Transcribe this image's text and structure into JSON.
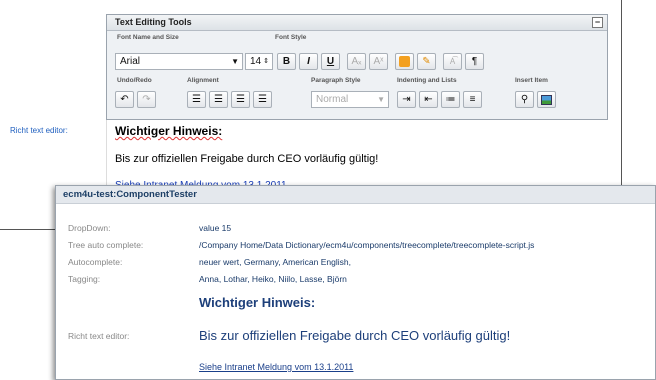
{
  "back_panel": {
    "rte_label": "Richt text editor:",
    "tools_title": "Text Editing Tools",
    "collapse_symbol": "−",
    "groups": {
      "font_name_size": "Font Name and Size",
      "font_style": "Font Style",
      "undo_redo": "Undo/Redo",
      "alignment": "Alignment",
      "paragraph_style": "Paragraph Style",
      "indenting_lists": "Indenting and Lists",
      "insert_item": "Insert Item"
    },
    "font_name": "Arial",
    "font_size": "14",
    "paragraph_style_value": "Normal",
    "buttons": {
      "bold": "B",
      "italic": "I",
      "underline": "U",
      "subscript": "Aₓ",
      "superscript": "Aˣ",
      "pilcrow": "¶"
    },
    "editor": {
      "heading": "Wichtiger Hinweis:",
      "body": "Bis zur offiziellen Freigabe durch CEO vorläufig gültig!",
      "link": "Siehe Intranet Meldung vom 13.1.2011"
    }
  },
  "front_panel": {
    "title": "ecm4u-test:ComponentTester",
    "rows": [
      {
        "label": "DropDown:",
        "value": "value 15"
      },
      {
        "label": "Tree auto complete:",
        "value": "/Company Home/Data Dictionary/ecm4u/components/treecomplete/treecomplete-script.js"
      },
      {
        "label": "Autocomplete:",
        "value": "neuer wert, Germany, American English,"
      },
      {
        "label": "Tagging:",
        "value": "Anna, Lothar, Heiko, Niilo, Lasse, Björn"
      }
    ],
    "rte_label": "Richt text editor:",
    "heading": "Wichtiger Hinweis:",
    "body": "Bis zur offiziellen Freigabe durch CEO vorläufig gültig!",
    "link": "Siehe Intranet Meldung vom 13.1.2011"
  }
}
